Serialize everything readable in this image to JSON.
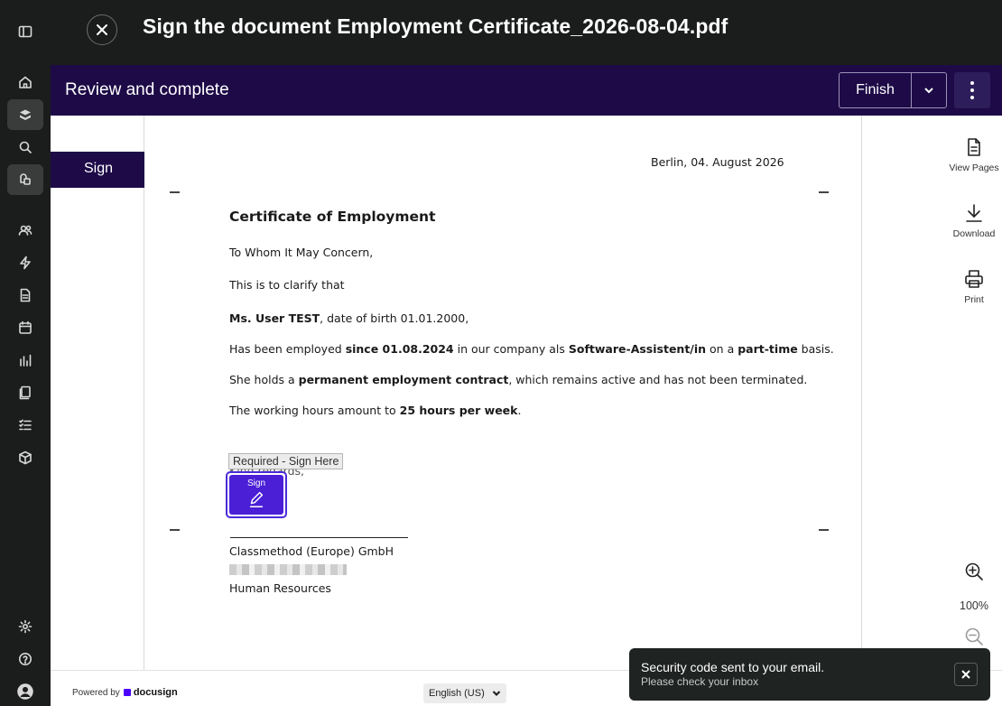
{
  "header": {
    "document_title": "Sign the document Employment Certificate_2026-08-04.pdf",
    "close_icon": "close-icon"
  },
  "review_bar": {
    "title": "Review and complete",
    "finish_label": "Finish",
    "background": "#1d0a47"
  },
  "sign_flag": {
    "label": "Sign",
    "color": "#1d0a47"
  },
  "document": {
    "date_line": "Berlin, 04. August 2026",
    "title": "Certificate of Employment",
    "salutation": "To Whom It May Concern,",
    "intro": "This is to clarify that",
    "person_name": "Ms. User TEST",
    "person_rest": ", date of birth 01.01.2000,",
    "employed_pre": "Has been employed ",
    "employed_since": "since 01.08.2024",
    "employed_mid": " in our company als ",
    "employed_role": "Software-Assistent/in",
    "employed_mid2": " on a ",
    "employed_type": "part-time",
    "employed_post": " basis.",
    "contract_pre": "She holds a ",
    "contract_bold": "permanent employment contract",
    "contract_post": ", which remains active and has not been terminated.",
    "hours_pre": "The working hours amount to ",
    "hours_bold": "25 hours per week",
    "hours_post": ".",
    "closing_partial": "Kind regards,",
    "company": "Classmethod (Europe) GmbH",
    "department": "Human Resources"
  },
  "sign_field": {
    "required_label": "Required - Sign Here",
    "tag_label": "Sign",
    "accent": "#4a1fd6"
  },
  "tools": {
    "view_pages": "View Pages",
    "download": "Download",
    "print": "Print",
    "zoom": "100%"
  },
  "footer": {
    "powered_by": "Powered by",
    "brand": "docusign",
    "language": "English (US)"
  },
  "toast": {
    "title": "Security code sent to your email.",
    "message": "Please check your inbox"
  }
}
